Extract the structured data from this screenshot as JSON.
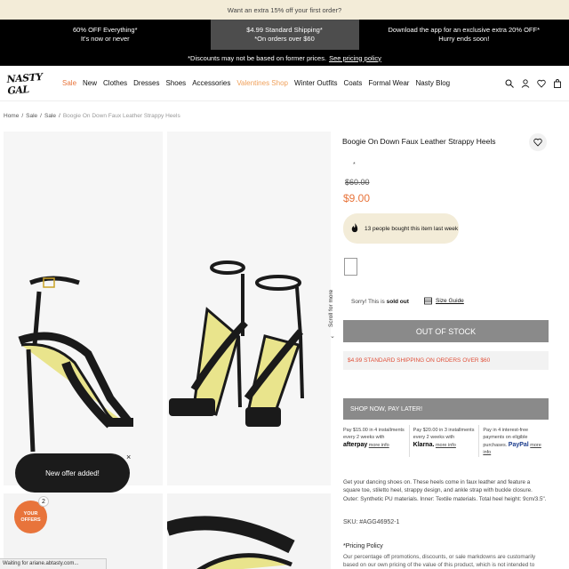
{
  "topbar": {
    "text": "Want an extra 15% off your first order?"
  },
  "promos": [
    {
      "line1": "60% OFF Everything*",
      "line2": "It's now or never"
    },
    {
      "line1": "$4.99 Standard Shipping*",
      "line2": "*On orders over $60"
    },
    {
      "line1": "Download the app for an exclusive extra 20% OFF*",
      "line2": "Hurry ends soon!"
    }
  ],
  "disclaimer": {
    "text": "*Discounts may not be based on former prices.",
    "link": "See pricing policy"
  },
  "nav": {
    "logo": "NASTY GAL",
    "links": [
      "Sale",
      "New",
      "Clothes",
      "Dresses",
      "Shoes",
      "Accessories",
      "Valentines Shop",
      "Winter Outfits",
      "Coats",
      "Formal Wear",
      "Nasty Blog"
    ],
    "icons": [
      "search-icon",
      "account-icon",
      "wishlist-icon",
      "bag-icon"
    ]
  },
  "breadcrumbs": [
    "Home",
    "Sale",
    "Sale",
    "Boogie On Down Faux Leather Strappy Heels"
  ],
  "scroll_hint": "Scroll for more",
  "product": {
    "title": "Boogie On Down Faux Leather Strappy Heels",
    "star": "*",
    "price_old": "$60.00",
    "price_new": "$9.00",
    "bought_text": "13 people bought this item last week",
    "sold_out_prefix": "Sorry! This is",
    "sold_out_bold": "sold out",
    "size_guide": "Size Guide",
    "out_of_stock": "OUT OF STOCK",
    "shipping_note": "$4.99 STANDARD SHIPPING ON ORDERS OVER $60",
    "pay_later": "SHOP NOW, PAY LATER!",
    "installments": [
      {
        "text": "Pay $15.00 in 4 installments every 2 weeks with",
        "brand": "afterpay",
        "more": "more info"
      },
      {
        "text": "Pay $20.00 in 3 installments every 2 weeks with",
        "brand": "Klarna.",
        "more": "more info"
      },
      {
        "text": "Pay in 4 interest-free payments on eligible purchases.",
        "brand": "PayPal",
        "more": "more info"
      }
    ],
    "description": "Get your dancing shoes on. These heels come in faux leather and feature a square toe, stiletto heel, strappy design, and ankle strap with buckle closure.",
    "materials": "Outer: Synthetic PU materials. Inner: Textile materials. Total heel height: 9cm/3.5\".",
    "sku": "SKU: #AGG46952-1",
    "policy_heading": "*Pricing Policy",
    "policy_text": "Our percentage off promotions, discounts, or sale markdowns are customarily based on our own pricing of the value of this product, which is not intended to reflect a"
  },
  "toast": {
    "text": "New offer added!",
    "close": "×"
  },
  "offers": {
    "label": "YOUR OFFERS",
    "count": "2"
  },
  "statusbar": "Waiting for ariane.abtasty.com...",
  "colors": {
    "accent": "#e8743b",
    "dark": "#000000",
    "grey_button": "#8a8a8a",
    "cream": "#f3ecd8"
  }
}
